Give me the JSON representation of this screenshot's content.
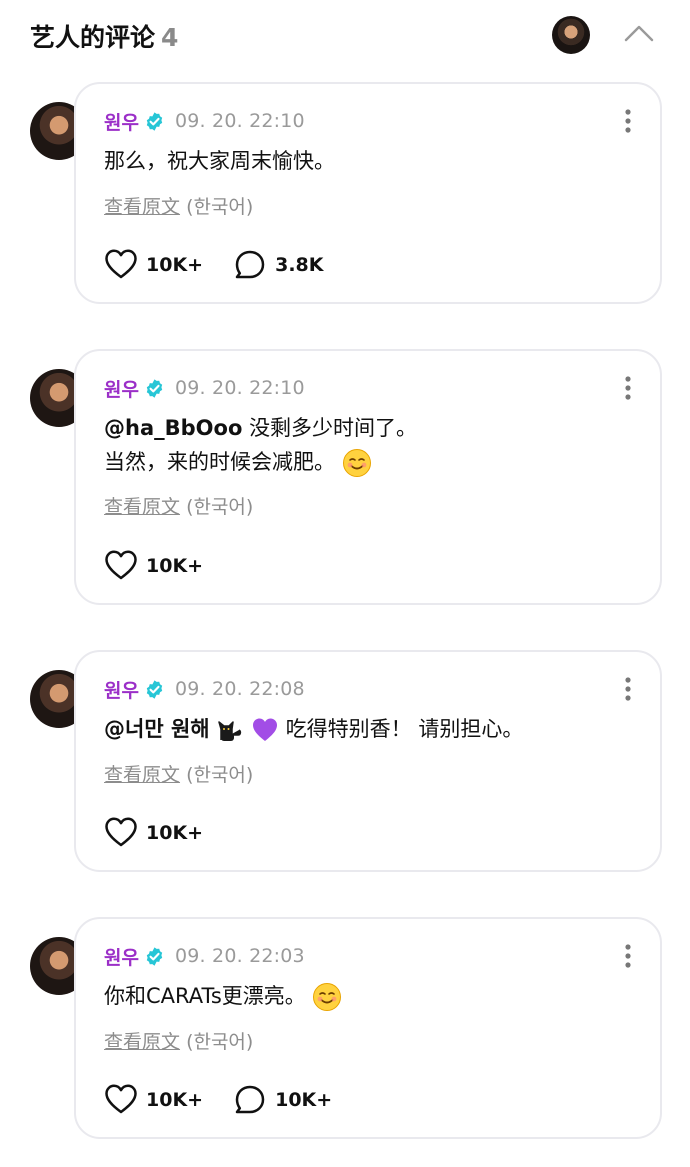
{
  "header": {
    "title": "艺人的评论",
    "count": "4"
  },
  "comments": [
    {
      "author": "원우",
      "time": "09. 20. 22:10",
      "mention": "",
      "line1": "那么，祝大家周末愉快。",
      "line2": "",
      "view_original": "查看原文",
      "language": "(한국어)",
      "likes": "10K+",
      "replies": "3.8K"
    },
    {
      "author": "원우",
      "time": "09. 20. 22:10",
      "mention": "@ha_BbOoo",
      "line1": "没剩多少时间了。",
      "line2": "当然，来的时候会减肥。",
      "view_original": "查看原文",
      "language": "(한국어)",
      "likes": "10K+",
      "replies": ""
    },
    {
      "author": "원우",
      "time": "09. 20. 22:08",
      "mention": "@너만 원해",
      "line1": "吃得特别香！ 请别担心。",
      "line2": "",
      "view_original": "查看原文",
      "language": "(한국어)",
      "likes": "10K+",
      "replies": ""
    },
    {
      "author": "원우",
      "time": "09. 20. 22:03",
      "mention": "",
      "line1": "你和CARATs更漂亮。",
      "line2": "",
      "view_original": "查看原文",
      "language": "(한국어)",
      "likes": "10K+",
      "replies": "10K+"
    }
  ],
  "icons": {
    "verified": "verified-badge-icon",
    "more": "more-vertical-icon",
    "like": "heart-outline-icon",
    "reply": "speech-bubble-icon",
    "collapse": "chevron-up-icon",
    "smile": "smiling-face-emoji",
    "cat": "black-cat-emoji",
    "heart": "purple-heart-emoji"
  },
  "colors": {
    "author": "#9b2fc8",
    "verified": "#27c6d6",
    "time": "#9a9a9a",
    "muted": "#8d8d8d",
    "card_border": "#e9e9ee"
  }
}
